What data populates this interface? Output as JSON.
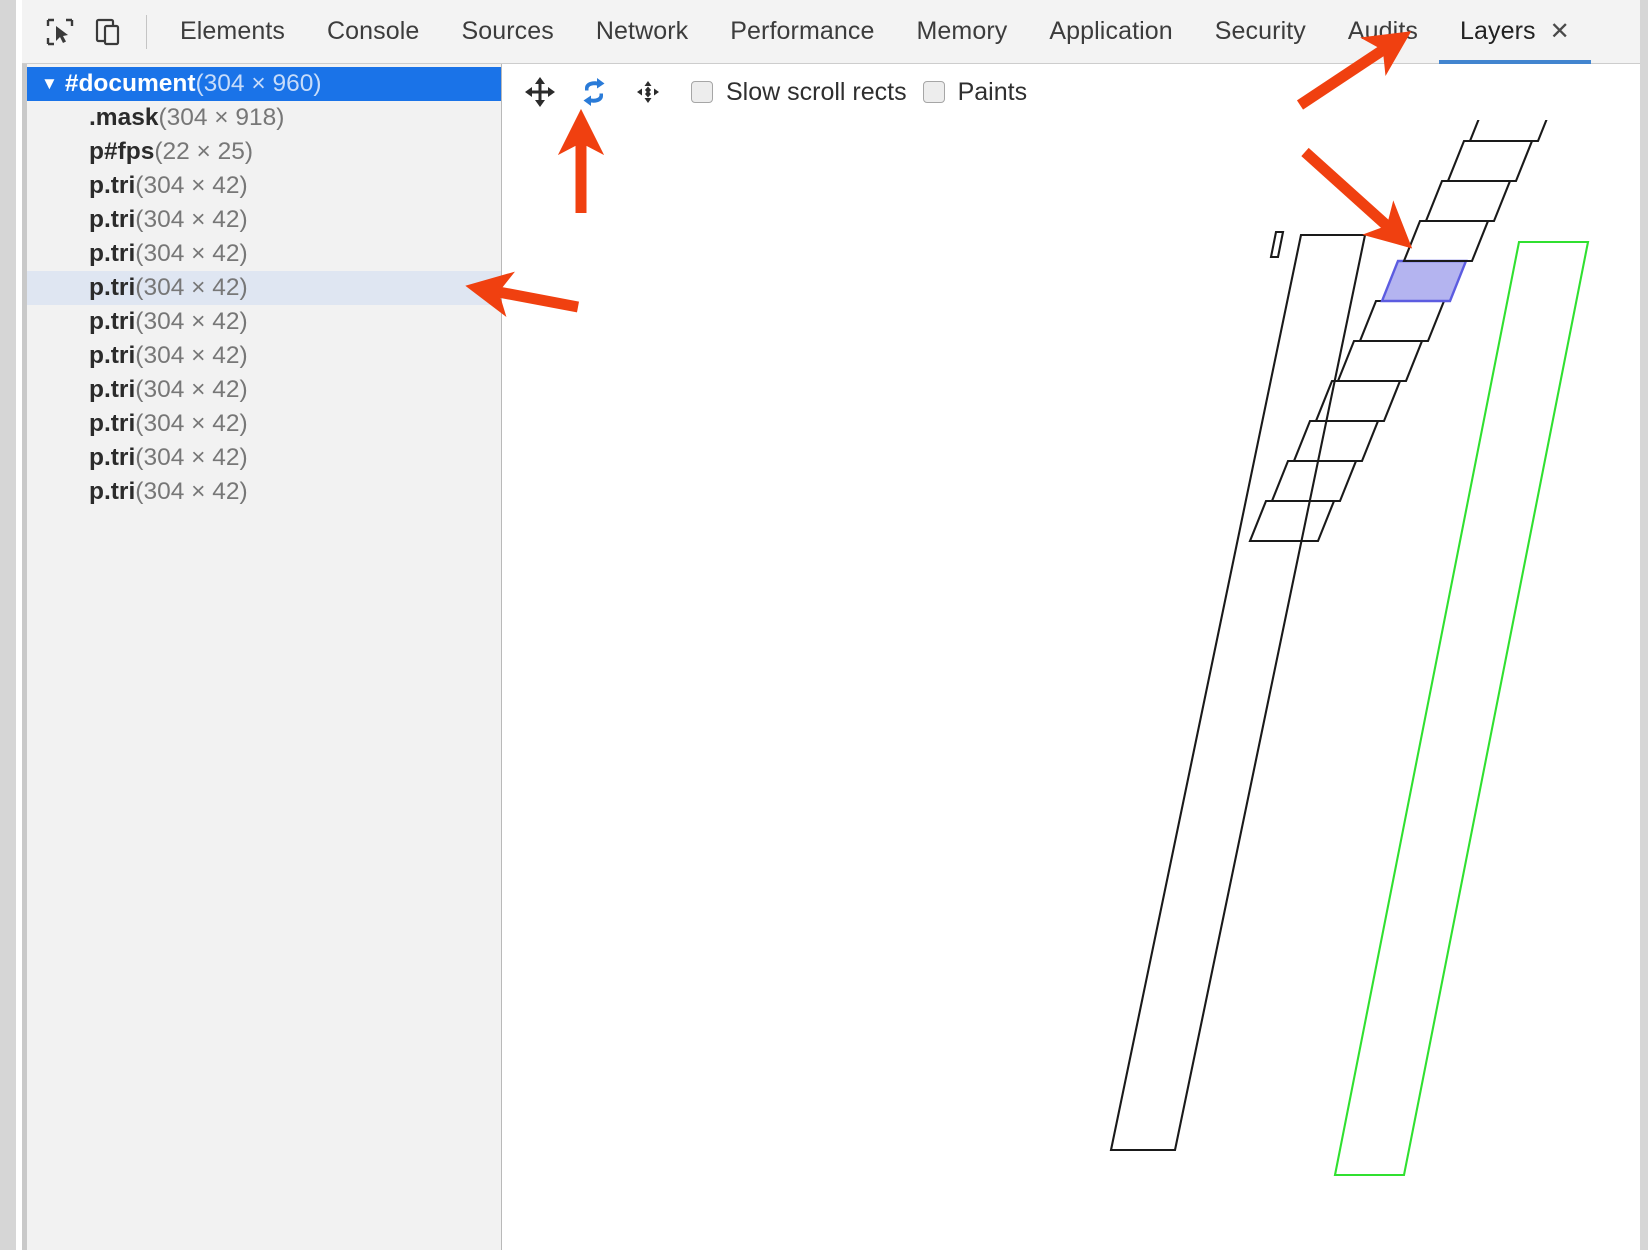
{
  "window": {
    "app": "Chrome DevTools"
  },
  "toolbar": {
    "inspect_icon": "inspect-cursor-icon",
    "device_icon": "device-toolbar-icon"
  },
  "tabs": [
    {
      "label": "Elements",
      "active": false
    },
    {
      "label": "Console",
      "active": false
    },
    {
      "label": "Sources",
      "active": false
    },
    {
      "label": "Network",
      "active": false
    },
    {
      "label": "Performance",
      "active": false
    },
    {
      "label": "Memory",
      "active": false
    },
    {
      "label": "Application",
      "active": false
    },
    {
      "label": "Security",
      "active": false
    },
    {
      "label": "Audits",
      "active": false
    },
    {
      "label": "Layers",
      "active": true,
      "close_glyph": "✕"
    }
  ],
  "layers_toolbar": {
    "pan_icon": "pan-mode-icon",
    "rotate_icon": "rotate-mode-icon",
    "reset_icon": "reset-transform-icon",
    "checkboxes": [
      {
        "label": "Slow scroll rects",
        "checked": false
      },
      {
        "label": "Paints",
        "checked": false
      }
    ]
  },
  "layer_tree": {
    "rows": [
      {
        "name": "#document",
        "dims": "(304 × 960)",
        "depth": 0,
        "expanded": true,
        "caret": "▼",
        "state": "root-selected"
      },
      {
        "name": ".mask",
        "dims": "(304 × 918)",
        "depth": 1,
        "state": "normal"
      },
      {
        "name": "p#fps",
        "dims": "(22 × 25)",
        "depth": 1,
        "state": "normal"
      },
      {
        "name": "p.tri",
        "dims": "(304 × 42)",
        "depth": 1,
        "state": "normal"
      },
      {
        "name": "p.tri",
        "dims": "(304 × 42)",
        "depth": 1,
        "state": "normal"
      },
      {
        "name": "p.tri",
        "dims": "(304 × 42)",
        "depth": 1,
        "state": "normal"
      },
      {
        "name": "p.tri",
        "dims": "(304 × 42)",
        "depth": 1,
        "state": "selected"
      },
      {
        "name": "p.tri",
        "dims": "(304 × 42)",
        "depth": 1,
        "state": "normal"
      },
      {
        "name": "p.tri",
        "dims": "(304 × 42)",
        "depth": 1,
        "state": "normal"
      },
      {
        "name": "p.tri",
        "dims": "(304 × 42)",
        "depth": 1,
        "state": "normal"
      },
      {
        "name": "p.tri",
        "dims": "(304 × 42)",
        "depth": 1,
        "state": "normal"
      },
      {
        "name": "p.tri",
        "dims": "(304 × 42)",
        "depth": 1,
        "state": "normal"
      },
      {
        "name": "p.tri",
        "dims": "(304 × 42)",
        "depth": 1,
        "state": "normal"
      }
    ]
  },
  "layer_view": {
    "selected_layer_fill": "#b4b4f0",
    "selected_layer_stroke": "#5c5ce0",
    "layer_outline_color": "#1a1a1a",
    "scroll_rect_color": "#30e030",
    "layer_count_visible": 12
  },
  "annotations": [
    {
      "name": "arrow-to-layers-tab",
      "color": "#f04010"
    },
    {
      "name": "arrow-to-rotate-button",
      "color": "#f04010"
    },
    {
      "name": "arrow-to-selected-tree-row",
      "color": "#f04010"
    },
    {
      "name": "arrow-to-highlighted-layer",
      "color": "#f04010"
    }
  ]
}
